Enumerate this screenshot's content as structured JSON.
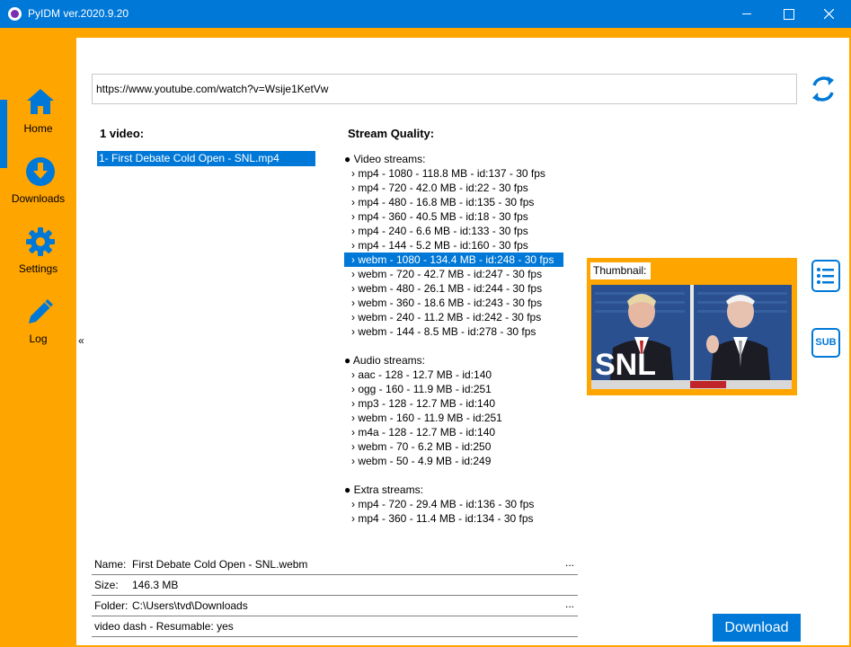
{
  "window": {
    "title": "PyIDM ver.2020.9.20"
  },
  "sidebar": {
    "items": [
      {
        "label": "Home",
        "icon": "home-icon"
      },
      {
        "label": "Downloads",
        "icon": "download-icon"
      },
      {
        "label": "Settings",
        "icon": "gear-icon"
      },
      {
        "label": "Log",
        "icon": "pencil-icon"
      }
    ],
    "toggle_label": "«"
  },
  "url": {
    "value": "https://www.youtube.com/watch?v=Wsije1KetVw"
  },
  "videos": {
    "count_label": "1 video:",
    "items": [
      "1- First Debate Cold Open - SNL.mp4"
    ]
  },
  "streams": {
    "title": "Stream Quality:",
    "video_header": "● Video streams:",
    "video": [
      "› mp4 - 1080 - 118.8 MB - id:137 - 30 fps",
      "› mp4 - 720 - 42.0 MB - id:22 - 30 fps",
      "› mp4 - 480 - 16.8 MB - id:135 - 30 fps",
      "› mp4 - 360 - 40.5 MB - id:18 - 30 fps",
      "› mp4 - 240 - 6.6 MB - id:133 - 30 fps",
      "› mp4 - 144 - 5.2 MB - id:160 - 30 fps",
      "› webm - 1080 - 134.4 MB - id:248 - 30 fps",
      "› webm - 720 - 42.7 MB - id:247 - 30 fps",
      "› webm - 480 - 26.1 MB - id:244 - 30 fps",
      "› webm - 360 - 18.6 MB - id:243 - 30 fps",
      "› webm - 240 - 11.2 MB - id:242 - 30 fps",
      "› webm - 144 - 8.5 MB - id:278 - 30 fps"
    ],
    "selected_index": 6,
    "audio_header": "● Audio streams:",
    "audio": [
      "› aac - 128 - 12.7 MB - id:140",
      "› ogg - 160 - 11.9 MB - id:251",
      "› mp3 - 128 - 12.7 MB - id:140",
      "› webm - 160 - 11.9 MB - id:251",
      "› m4a - 128 - 12.7 MB - id:140",
      "› webm - 70 - 6.2 MB - id:250",
      "› webm - 50 - 4.9 MB - id:249"
    ],
    "extra_header": "● Extra streams:",
    "extra": [
      "› mp4 - 720 - 29.4 MB - id:136 - 30 fps",
      "› mp4 - 360 - 11.4 MB - id:134 - 30 fps"
    ]
  },
  "thumbnail": {
    "label": "Thumbnail:",
    "logo_text": "SNL"
  },
  "buttons": {
    "sub": "SUB",
    "download": "Download"
  },
  "properties": {
    "name_key": "Name:",
    "name_value": "First Debate Cold Open - SNL.webm",
    "size_key": "Size:",
    "size_value": "146.3 MB",
    "folder_key": "Folder:",
    "folder_value": "C:\\Users\\tvd\\Downloads",
    "info": "video  dash  - Resumable: yes",
    "ellipsis": "..."
  },
  "colors": {
    "accent": "#0078d7",
    "frame": "#ffa500"
  }
}
